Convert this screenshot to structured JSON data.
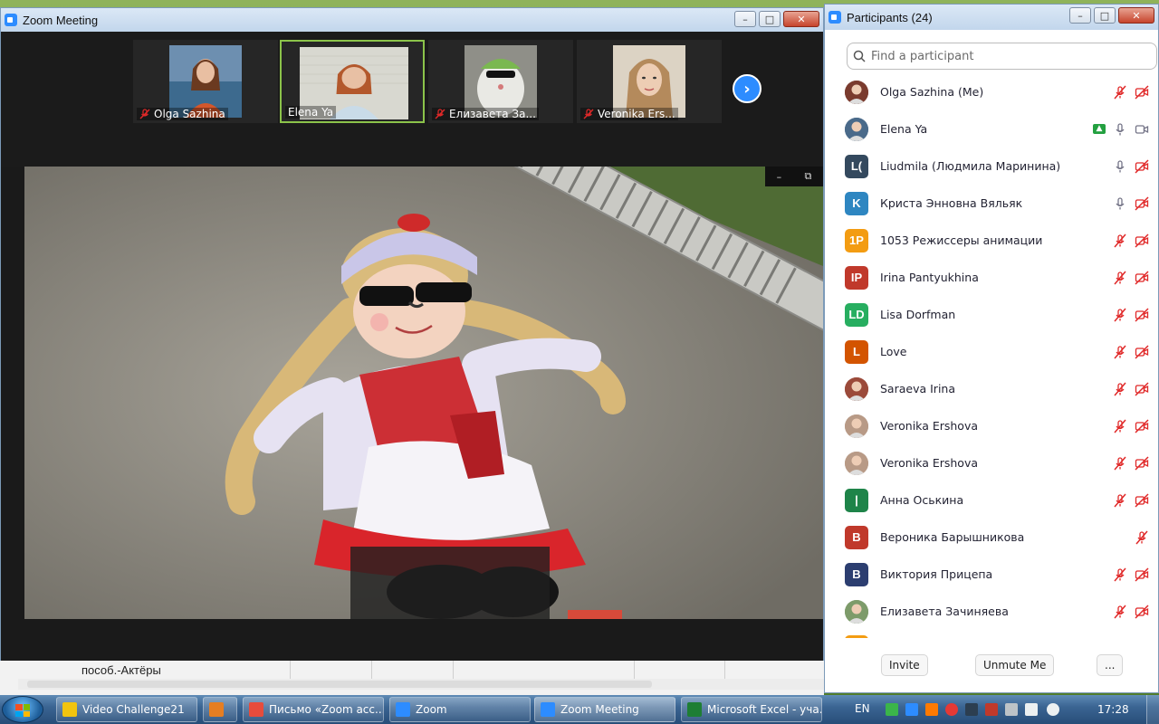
{
  "zoom_window": {
    "title": "Zoom Meeting",
    "minimize": "–",
    "maximize": "□",
    "close": "✕"
  },
  "thumbnails": [
    {
      "name": "Olga Sazhina",
      "muted": true
    },
    {
      "name": "Elena Ya",
      "muted": false,
      "active": true
    },
    {
      "name": "Елизавета За...",
      "muted": true
    },
    {
      "name": "Veronika Ers...",
      "muted": true
    }
  ],
  "next_page_glyph": "›",
  "video_controls": {
    "minimize": "–",
    "restore": "⧉"
  },
  "background_app": {
    "cell_text": "пособ.-Актёры"
  },
  "participants_window": {
    "title": "Participants (24)",
    "search_placeholder": "Find a participant",
    "invite_label": "Invite",
    "unmute_label": "Unmute Me",
    "more_label": "...",
    "participants": [
      {
        "name": "Olga Sazhina (Me)",
        "initials": "",
        "avatar_color": "#7a3b2e",
        "photo": true,
        "mic": "muted",
        "video": "off"
      },
      {
        "name": "Elena Ya",
        "initials": "",
        "avatar_color": "#4a6a8a",
        "photo": true,
        "mic": "on",
        "video": "on",
        "sharing": true
      },
      {
        "name": "Liudmila (Людмила Маринина)",
        "initials": "L(",
        "avatar_color": "#34495e",
        "mic": "on",
        "video": "off"
      },
      {
        "name": "Криста Энновна Вяльяк",
        "initials": "K",
        "avatar_color": "#2e86c1",
        "mic": "on",
        "video": "off"
      },
      {
        "name": "1053 Режиссеры анимации",
        "initials": "1P",
        "avatar_color": "#f39c12",
        "mic": "muted",
        "video": "off"
      },
      {
        "name": "Irina Pantyukhina",
        "initials": "IP",
        "avatar_color": "#c0392b",
        "mic": "muted",
        "video": "off"
      },
      {
        "name": "Lisa Dorfman",
        "initials": "LD",
        "avatar_color": "#27ae60",
        "mic": "muted",
        "video": "off"
      },
      {
        "name": "Love",
        "initials": "L",
        "avatar_color": "#d35400",
        "mic": "muted",
        "video": "off"
      },
      {
        "name": "Saraeva Irina",
        "initials": "",
        "avatar_color": "#9b4a3a",
        "photo": true,
        "mic": "muted",
        "video": "off"
      },
      {
        "name": "Veronika Ershova",
        "initials": "",
        "avatar_color": "#b89a86",
        "photo": true,
        "mic": "muted",
        "video": "off"
      },
      {
        "name": "Veronika Ershova",
        "initials": "",
        "avatar_color": "#b89a86",
        "photo": true,
        "mic": "muted",
        "video": "off"
      },
      {
        "name": "Анна Оськина",
        "initials": "|",
        "avatar_color": "#1e8449",
        "mic": "muted",
        "video": "off"
      },
      {
        "name": "Вероника Барышникова",
        "initials": "B",
        "avatar_color": "#c0392b",
        "mic": "muted",
        "video": "none"
      },
      {
        "name": "Виктория Прицепа",
        "initials": "B",
        "avatar_color": "#2c3e70",
        "mic": "muted",
        "video": "off"
      },
      {
        "name": "Елизавета Зачиняева",
        "initials": "",
        "avatar_color": "#7d9b6a",
        "photo": true,
        "mic": "muted",
        "video": "off"
      }
    ]
  },
  "taskbar": {
    "items": [
      {
        "label": "Video Challenge21",
        "icon_color": "#f1c40f"
      },
      {
        "label": "",
        "icon_color": "#e67e22"
      },
      {
        "label": "Письмо «Zoom acc...",
        "icon_color": "#e74c3c"
      },
      {
        "label": "Zoom",
        "icon_color": "#2d8cff"
      },
      {
        "label": "Zoom Meeting",
        "icon_color": "#2d8cff",
        "active": true
      },
      {
        "label": "Microsoft Excel - уча...",
        "icon_color": "#1e7e34"
      }
    ],
    "language": "EN",
    "clock": "17:28"
  },
  "colors": {
    "zoom_blue": "#2d8cff",
    "muted_red": "#e02828",
    "share_green": "#23a040"
  }
}
